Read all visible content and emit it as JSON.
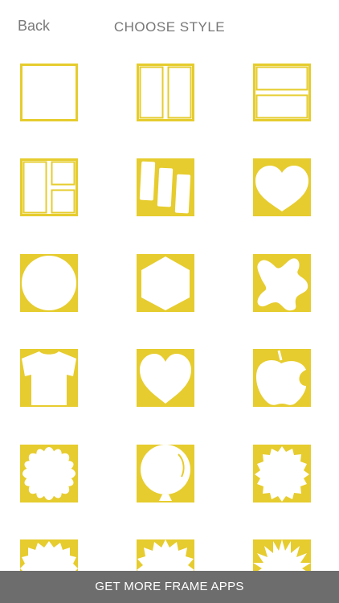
{
  "header": {
    "back_label": "Back",
    "title": "CHOOSE STYLE"
  },
  "colors": {
    "accent": "#E6CC2E",
    "background": "#FFFFFF",
    "bottom_bar": "#6D6D6D",
    "text_gray": "#777777"
  },
  "styles": [
    {
      "name": "single-frame"
    },
    {
      "name": "two-vertical-frames"
    },
    {
      "name": "two-horizontal-frames"
    },
    {
      "name": "three-panel-frames"
    },
    {
      "name": "three-tilted-strips"
    },
    {
      "name": "heart-rounded"
    },
    {
      "name": "circle"
    },
    {
      "name": "hexagon"
    },
    {
      "name": "splat"
    },
    {
      "name": "t-shirt"
    },
    {
      "name": "heart"
    },
    {
      "name": "apple"
    },
    {
      "name": "flower"
    },
    {
      "name": "balloon"
    },
    {
      "name": "starburst-wavy"
    },
    {
      "name": "sunburst-bumpy"
    },
    {
      "name": "sunburst-pointed"
    },
    {
      "name": "spiky-star"
    }
  ],
  "bottom_bar": {
    "label": "GET MORE FRAME APPS"
  }
}
